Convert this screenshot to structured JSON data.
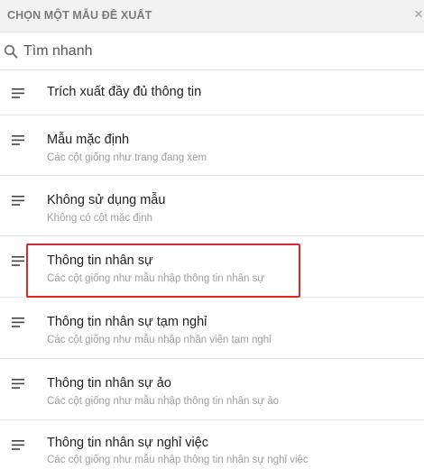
{
  "dialog": {
    "title": "CHỌN MỘT MẪU ĐỀ XUẤT",
    "close_glyph": "×",
    "close_icon": "close-icon"
  },
  "search": {
    "placeholder": "Tìm nhanh",
    "value": "",
    "icon": "search-icon"
  },
  "templates": [
    {
      "title": "Trích xuất đầy đủ thông tin",
      "subtitle": "",
      "icon": "lines-icon",
      "highlighted": false
    },
    {
      "title": "Mẫu mặc định",
      "subtitle": "Các cột giống như trang đang xem",
      "icon": "lines-icon",
      "highlighted": false
    },
    {
      "title": "Không sử dụng mẫu",
      "subtitle": "Không có cột mặc định",
      "icon": "lines-icon",
      "highlighted": false
    },
    {
      "title": "Thông tin nhân sự",
      "subtitle": "Các cột giống như mẫu nhập thông tin nhân sự",
      "icon": "lines-icon",
      "highlighted": true
    },
    {
      "title": "Thông tin nhân sự tạm nghỉ",
      "subtitle": "Các cột giống như mẫu nhập nhân viên tạm nghỉ",
      "icon": "lines-icon",
      "highlighted": false
    },
    {
      "title": "Thông tin nhân sự ảo",
      "subtitle": "Các cột giống như mẫu nhập thông tin nhân sự ảo",
      "icon": "lines-icon",
      "highlighted": false
    },
    {
      "title": "Thông tin nhân sự nghỉ việc",
      "subtitle": "Các cột giống như mẫu nhập thông tin nhân sự nghỉ việc",
      "icon": "lines-icon",
      "highlighted": false
    }
  ],
  "colors": {
    "highlight_border": "#e32626",
    "header_background": "#f2f2f2",
    "subtitle_text": "#9e9e9e"
  }
}
